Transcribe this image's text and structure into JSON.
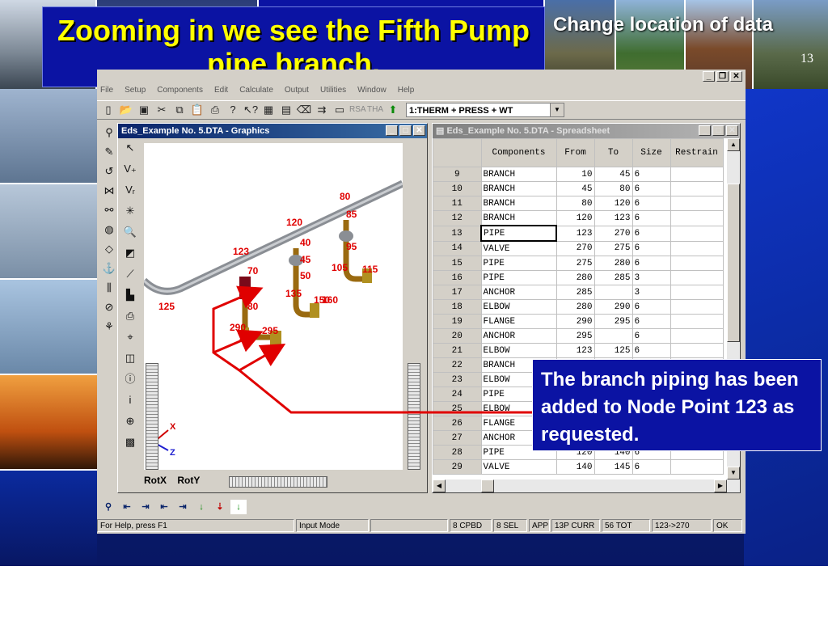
{
  "slide": {
    "title": "Zooming in we see the Fifth Pump pipe branch.",
    "section_label": "Change location of data",
    "slide_number": "13",
    "callout": "The branch piping has been added to Node Point 123 as requested."
  },
  "app": {
    "menu": [
      "File",
      "Setup",
      "Components",
      "Edit",
      "Calculate",
      "Output",
      "Utilities",
      "Window",
      "Help"
    ],
    "combo_value": "1:THERM + PRESS + WT",
    "toolbar_labels": {
      "rsa": "RSA",
      "tha": "THA"
    },
    "graphics_window": {
      "title": "Eds_Example No. 5.DTA - Graphics",
      "rotx_label": "RotX",
      "roty_label": "RotY",
      "node_labels": [
        "80",
        "120",
        "85",
        "40",
        "123",
        "95",
        "115",
        "70",
        "45",
        "105",
        "50",
        "125",
        "80",
        "135",
        "150",
        "160",
        "290",
        "295",
        "285"
      ],
      "axis_labels": {
        "y": "Y",
        "x": "X",
        "z": "Z"
      }
    },
    "spreadsheet_window": {
      "title": "Eds_Example No. 5.DTA - Spreadsheet",
      "columns": [
        "Components",
        "From",
        "To",
        "Size",
        "Restrain"
      ],
      "rows": [
        {
          "n": "9",
          "comp": "BRANCH",
          "from": "10",
          "to": "45",
          "size": "6"
        },
        {
          "n": "10",
          "comp": "BRANCH",
          "from": "45",
          "to": "80",
          "size": "6"
        },
        {
          "n": "11",
          "comp": "BRANCH",
          "from": "80",
          "to": "120",
          "size": "6"
        },
        {
          "n": "12",
          "comp": "BRANCH",
          "from": "120",
          "to": "123",
          "size": "6"
        },
        {
          "n": "13",
          "comp": "PIPE",
          "from": "123",
          "to": "270",
          "size": "6"
        },
        {
          "n": "14",
          "comp": "VALVE",
          "from": "270",
          "to": "275",
          "size": "6"
        },
        {
          "n": "15",
          "comp": "PIPE",
          "from": "275",
          "to": "280",
          "size": "6"
        },
        {
          "n": "16",
          "comp": "PIPE",
          "from": "280",
          "to": "285",
          "size": "3"
        },
        {
          "n": "17",
          "comp": "ANCHOR",
          "from": "285",
          "to": "",
          "size": "3"
        },
        {
          "n": "18",
          "comp": "ELBOW",
          "from": "280",
          "to": "290",
          "size": "6"
        },
        {
          "n": "19",
          "comp": "FLANGE",
          "from": "290",
          "to": "295",
          "size": "6"
        },
        {
          "n": "20",
          "comp": "ANCHOR",
          "from": "295",
          "to": "",
          "size": "6"
        },
        {
          "n": "21",
          "comp": "ELBOW",
          "from": "123",
          "to": "125",
          "size": "6"
        },
        {
          "n": "22",
          "comp": "BRANCH",
          "from": "",
          "to": "",
          "size": ""
        },
        {
          "n": "23",
          "comp": "ELBOW",
          "from": "",
          "to": "",
          "size": ""
        },
        {
          "n": "24",
          "comp": "PIPE",
          "from": "",
          "to": "",
          "size": ""
        },
        {
          "n": "25",
          "comp": "ELBOW",
          "from": "",
          "to": "",
          "size": ""
        },
        {
          "n": "26",
          "comp": "FLANGE",
          "from": "",
          "to": "",
          "size": ""
        },
        {
          "n": "27",
          "comp": "ANCHOR",
          "from": "",
          "to": "",
          "size": ""
        },
        {
          "n": "28",
          "comp": "PIPE",
          "from": "120",
          "to": "140",
          "size": "6"
        },
        {
          "n": "29",
          "comp": "VALVE",
          "from": "140",
          "to": "145",
          "size": "6"
        }
      ],
      "selected_row_index": 4
    },
    "status_bar": [
      "For Help, press F1",
      "Input Mode",
      "",
      "8 CPBD",
      "8 SEL",
      "APP",
      "13P CURR",
      "56 TOT",
      "123->270",
      "OK"
    ]
  },
  "colors": {
    "title_text": "#ffff00",
    "title_bg": "#0b13a3",
    "slide_bg": "#0a2a9e",
    "arrow": "#e00000"
  }
}
